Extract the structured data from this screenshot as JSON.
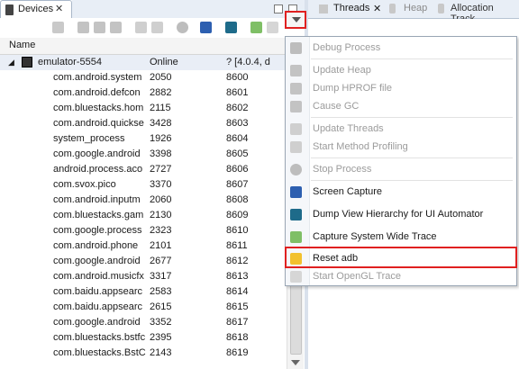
{
  "devices_view": {
    "tab_label": "Devices",
    "tab_close": "✕",
    "column_header": "Name",
    "device": {
      "name": "emulator-5554",
      "status": "Online",
      "info": "? [4.0.4, d"
    },
    "processes": [
      {
        "name": "com.android.system",
        "pid": "2050",
        "port": "8600"
      },
      {
        "name": "com.android.defcon",
        "pid": "2882",
        "port": "8601"
      },
      {
        "name": "com.bluestacks.hom",
        "pid": "2115",
        "port": "8602"
      },
      {
        "name": "com.android.quickse",
        "pid": "3428",
        "port": "8603"
      },
      {
        "name": "system_process",
        "pid": "1926",
        "port": "8604"
      },
      {
        "name": "com.google.android",
        "pid": "3398",
        "port": "8605"
      },
      {
        "name": "android.process.aco",
        "pid": "2727",
        "port": "8606"
      },
      {
        "name": "com.svox.pico",
        "pid": "3370",
        "port": "8607"
      },
      {
        "name": "com.android.inputm",
        "pid": "2060",
        "port": "8608"
      },
      {
        "name": "com.bluestacks.gam",
        "pid": "2130",
        "port": "8609"
      },
      {
        "name": "com.google.process",
        "pid": "2323",
        "port": "8610"
      },
      {
        "name": "com.android.phone",
        "pid": "2101",
        "port": "8611"
      },
      {
        "name": "com.google.android",
        "pid": "2677",
        "port": "8612"
      },
      {
        "name": "com.android.musicfx",
        "pid": "3317",
        "port": "8613"
      },
      {
        "name": "com.baidu.appsearc",
        "pid": "2583",
        "port": "8614"
      },
      {
        "name": "com.baidu.appsearc",
        "pid": "2615",
        "port": "8615"
      },
      {
        "name": "com.google.android",
        "pid": "3352",
        "port": "8617"
      },
      {
        "name": "com.bluestacks.bstfc",
        "pid": "2395",
        "port": "8618"
      },
      {
        "name": "com.bluestacks.BstC",
        "pid": "2143",
        "port": "8619"
      }
    ]
  },
  "right_tabs": [
    {
      "label": "Threads",
      "close": "✕"
    },
    {
      "label": "Heap"
    },
    {
      "label": "Allocation Track"
    }
  ],
  "menu": {
    "items": [
      {
        "label": "Debug Process",
        "enabled": false,
        "icon": "debug-icon"
      },
      {
        "label": "Update Heap",
        "enabled": false,
        "icon": "update-heap-icon"
      },
      {
        "label": "Dump HPROF file",
        "enabled": false,
        "icon": "dump-hprof-icon"
      },
      {
        "label": "Cause GC",
        "enabled": false,
        "icon": "gc-icon"
      },
      {
        "label": "Update Threads",
        "enabled": false,
        "icon": "update-threads-icon"
      },
      {
        "label": "Start Method Profiling",
        "enabled": false,
        "icon": "profiling-icon"
      },
      {
        "label": "Stop Process",
        "enabled": false,
        "icon": "stop-icon"
      },
      {
        "label": "Screen Capture",
        "enabled": true,
        "icon": "camera-icon"
      },
      {
        "label": "Dump View Hierarchy for UI Automator",
        "enabled": true,
        "icon": "hierarchy-icon"
      },
      {
        "label": "Capture System Wide Trace",
        "enabled": true,
        "icon": "systrace-icon"
      },
      {
        "label": "Reset adb",
        "enabled": true,
        "icon": "warning-icon"
      },
      {
        "label": "Start OpenGL Trace",
        "enabled": false,
        "icon": "opengl-icon"
      }
    ]
  },
  "colors": {
    "highlight_border": "#e02020",
    "tab_bar": "#e8eef6"
  }
}
